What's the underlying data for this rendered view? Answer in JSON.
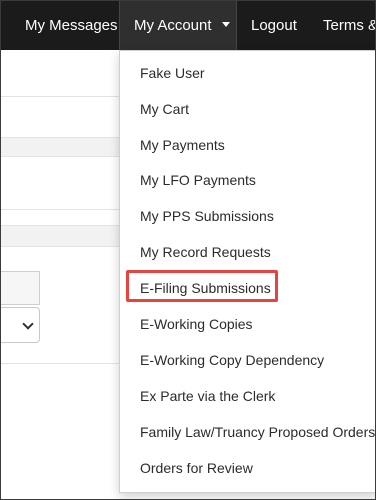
{
  "nav": {
    "items": [
      {
        "label": "My Messages"
      },
      {
        "label": "My Account"
      },
      {
        "label": "Logout"
      },
      {
        "label": "Terms & C"
      }
    ]
  },
  "dropdown": {
    "items": [
      {
        "label": "Fake User"
      },
      {
        "label": "My Cart"
      },
      {
        "label": "My Payments"
      },
      {
        "label": "My LFO Payments"
      },
      {
        "label": "My PPS Submissions"
      },
      {
        "label": "My Record Requests"
      },
      {
        "label": "E-Filing Submissions"
      },
      {
        "label": "E-Working Copies"
      },
      {
        "label": "E-Working Copy Dependency"
      },
      {
        "label": "Ex Parte via the Clerk"
      },
      {
        "label": "Family Law/Truancy Proposed Orders"
      },
      {
        "label": "Orders for Review"
      }
    ],
    "highlighted_item": "E-Filing Submissions",
    "highlight_color": "#e8433f"
  },
  "colors": {
    "nav_background": "#1b1b1b",
    "nav_active_background": "#2f2f2f"
  }
}
